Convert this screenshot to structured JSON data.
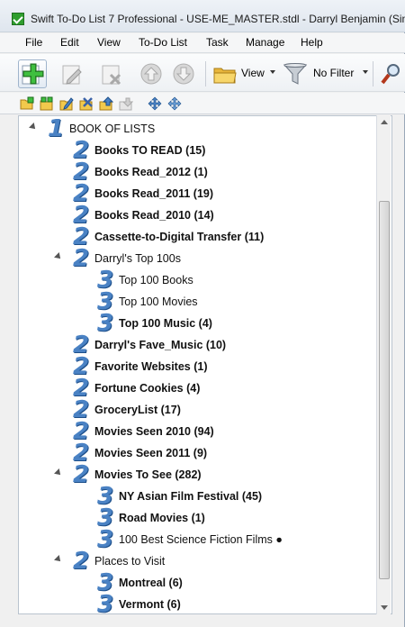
{
  "window": {
    "title": "Swift To-Do List 7 Professional - USE-ME_MASTER.stdl - Darryl Benjamin (Sin"
  },
  "menu": {
    "file": "File",
    "edit": "Edit",
    "view": "View",
    "todo_list": "To-Do List",
    "task": "Task",
    "manage": "Manage",
    "help": "Help"
  },
  "toolbar": {
    "view_label": "View",
    "filter_label": "No Filter",
    "icons": [
      "add-task-icon",
      "edit-icon",
      "delete-icon",
      "move-up-icon",
      "move-down-icon",
      "folder-icon",
      "filter-icon",
      "search-icon"
    ]
  },
  "subtoolbar": {
    "icons": [
      "new-folder-icon",
      "new-subfolder-icon",
      "rename-icon",
      "delete-list-icon",
      "move-list-up-icon",
      "move-list-down-icon",
      "expand-all-icon",
      "collapse-all-icon"
    ]
  },
  "tree": {
    "root": {
      "level": "1",
      "label": "BOOK OF LISTS",
      "expanded": true
    },
    "items": [
      {
        "level": "2",
        "label": "Books TO READ (15)",
        "bold": true
      },
      {
        "level": "2",
        "label": "Books Read_2012 (1)",
        "bold": true
      },
      {
        "level": "2",
        "label": "Books Read_2011 (19)",
        "bold": true
      },
      {
        "level": "2",
        "label": "Books Read_2010 (14)",
        "bold": true
      },
      {
        "level": "2",
        "label": "Cassette-to-Digital Transfer (11)",
        "bold": true
      },
      {
        "level": "2",
        "label": "Darryl's Top 100s",
        "bold": false,
        "expanded": true
      },
      {
        "level": "3",
        "label": "Top 100 Books",
        "bold": false
      },
      {
        "level": "3",
        "label": "Top 100 Movies",
        "bold": false
      },
      {
        "level": "3",
        "label": "Top 100 Music (4)",
        "bold": true
      },
      {
        "level": "2",
        "label": "Darryl's Fave_Music (10)",
        "bold": true
      },
      {
        "level": "2",
        "label": "Favorite Websites (1)",
        "bold": true
      },
      {
        "level": "2",
        "label": "Fortune Cookies (4)",
        "bold": true
      },
      {
        "level": "2",
        "label": "GroceryList (17)",
        "bold": true
      },
      {
        "level": "2",
        "label": "Movies Seen 2010 (94)",
        "bold": true
      },
      {
        "level": "2",
        "label": "Movies Seen 2011 (9)",
        "bold": true
      },
      {
        "level": "2",
        "label": "Movies To See (282)",
        "bold": true,
        "expanded": true
      },
      {
        "level": "3",
        "label": "NY Asian Film Festival (45)",
        "bold": true
      },
      {
        "level": "3",
        "label": "Road Movies (1)",
        "bold": true
      },
      {
        "level": "3",
        "label": "100 Best Science Fiction Films ●",
        "bold": false
      },
      {
        "level": "2",
        "label": "Places to Visit",
        "bold": false,
        "expanded": true
      },
      {
        "level": "3",
        "label": "Montreal (6)",
        "bold": true
      },
      {
        "level": "3",
        "label": "Vermont (6)",
        "bold": true
      }
    ]
  },
  "colors": {
    "level_number": "#4a82c4",
    "accent_green": "#2f9e2f",
    "folder_yellow": "#f2c94c"
  }
}
